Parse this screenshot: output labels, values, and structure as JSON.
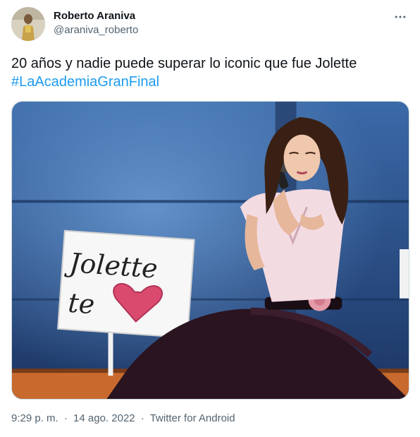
{
  "author": {
    "display_name": "Roberto Araniva",
    "handle": "@araniva_roberto"
  },
  "header": {
    "more_icon": "more-horizontal-icon"
  },
  "tweet": {
    "text": "20 años y nadie puede superar lo iconic que fue Jolette",
    "hashtag": "#LaAcademiaGranFinal"
  },
  "media": {
    "sign_text_line1": "Jolette",
    "sign_text_line2": "te"
  },
  "meta": {
    "time": "9:29 p. m.",
    "separator": "·",
    "date": "14 ago. 2022",
    "source": "Twitter for Android"
  },
  "colors": {
    "link": "#1d9bf0",
    "text_primary": "#0f1419",
    "text_secondary": "#536471"
  }
}
